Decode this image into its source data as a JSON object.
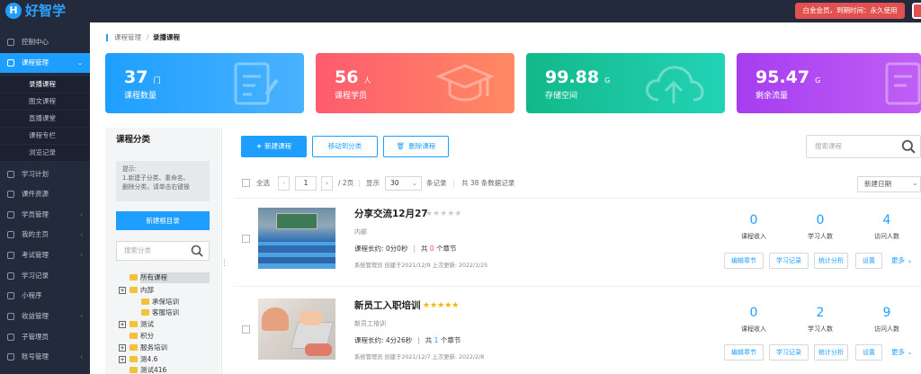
{
  "app": {
    "logo_letter": "H",
    "logo_name": "好智学",
    "vip_text": "白金会员，到期时间：永久使用"
  },
  "sidebar": {
    "items": [
      {
        "label": "控制中心",
        "icon": "home-icon"
      },
      {
        "label": "课程管理",
        "icon": "book-icon",
        "active": true
      },
      {
        "label": "学习计划",
        "icon": "plan-icon"
      },
      {
        "label": "课件资源",
        "icon": "folder-icon"
      },
      {
        "label": "学员管理",
        "icon": "users-icon"
      },
      {
        "label": "我的主页",
        "icon": "homepage-icon"
      },
      {
        "label": "考试管理",
        "icon": "exam-icon"
      },
      {
        "label": "学习记录",
        "icon": "record-icon"
      },
      {
        "label": "小程序",
        "icon": "miniapp-icon"
      },
      {
        "label": "收益管理",
        "icon": "income-icon"
      },
      {
        "label": "子管理员",
        "icon": "admin-icon"
      },
      {
        "label": "账号管理",
        "icon": "account-icon"
      }
    ],
    "subitems": [
      "录播课程",
      "图文课程",
      "直播课堂",
      "课程专栏",
      "浏览记录"
    ]
  },
  "breadcrumb": {
    "parent": "课程管理",
    "sep": "/",
    "current": "录播课程"
  },
  "stats": [
    {
      "num": "37",
      "unit": "门",
      "label": "课程数量",
      "color": "#1e9fff"
    },
    {
      "num": "56",
      "unit": "人",
      "label": "课程学员",
      "color": "#ff6b6b"
    },
    {
      "num": "99.88",
      "unit": "G",
      "label": "存储空间",
      "color": "#17c9a5"
    },
    {
      "num": "95.47",
      "unit": "G",
      "label": "剩余流量",
      "color": "#b43ef0"
    }
  ],
  "category": {
    "title": "课程分类",
    "tip_lines": [
      "提示:",
      "1.新建子分类、重命名、",
      "删除分类，请单击右键操"
    ],
    "new_root": "新建根目录",
    "search_placeholder": "搜索分类",
    "tree": [
      {
        "label": "所有课程",
        "plus": false
      },
      {
        "label": "内部",
        "plus": true
      },
      {
        "label": "承保培训",
        "plus": false
      },
      {
        "label": "客服培训",
        "plus": false
      },
      {
        "label": "测试",
        "plus": true
      },
      {
        "label": "积分",
        "plus": false
      },
      {
        "label": "服务培训",
        "plus": true
      },
      {
        "label": "测4.6",
        "plus": true
      },
      {
        "label": "测试416",
        "plus": false
      }
    ]
  },
  "toolbar": {
    "new_course": "新建课程",
    "move_to": "移动到分类",
    "delete": "删除课程",
    "search_placeholder": "搜索课程"
  },
  "pager": {
    "select_all": "全选",
    "page": "1",
    "total_pages": "/ 2页",
    "show": "显示",
    "per_page": "30",
    "records": "条记录",
    "total": "共 38 条数据记录",
    "sort": "新建日期"
  },
  "courses": [
    {
      "title": "分享交流12月27",
      "stars_filled": 0,
      "desc": "内部",
      "duration": "课程长约: 0分0秒",
      "chapters_prefix": "共",
      "chapters": "0",
      "chapters_suffix": "个章节",
      "meta": "系统管理员 创建于2021/12/9 上次更新: 2022/1/25",
      "income": "0",
      "students": "0",
      "visits": "4"
    },
    {
      "title": "新员工入职培训",
      "stars_filled": 5,
      "desc": "新员工培训",
      "duration": "课程长约: 4分26秒",
      "chapters_prefix": "共",
      "chapters": "1",
      "chapters_suffix": "个章节",
      "meta": "系统管理员 创建于2021/12/7 上次更新: 2022/2/8",
      "income": "0",
      "students": "2",
      "visits": "9"
    }
  ],
  "course_labels": {
    "income": "课程收入",
    "students": "学习人数",
    "visits": "访问人数",
    "sep": "|"
  },
  "course_actions": {
    "edit": "编辑章节",
    "record": "学习记录",
    "stats": "统计分析",
    "settings": "设置",
    "more": "更多"
  }
}
